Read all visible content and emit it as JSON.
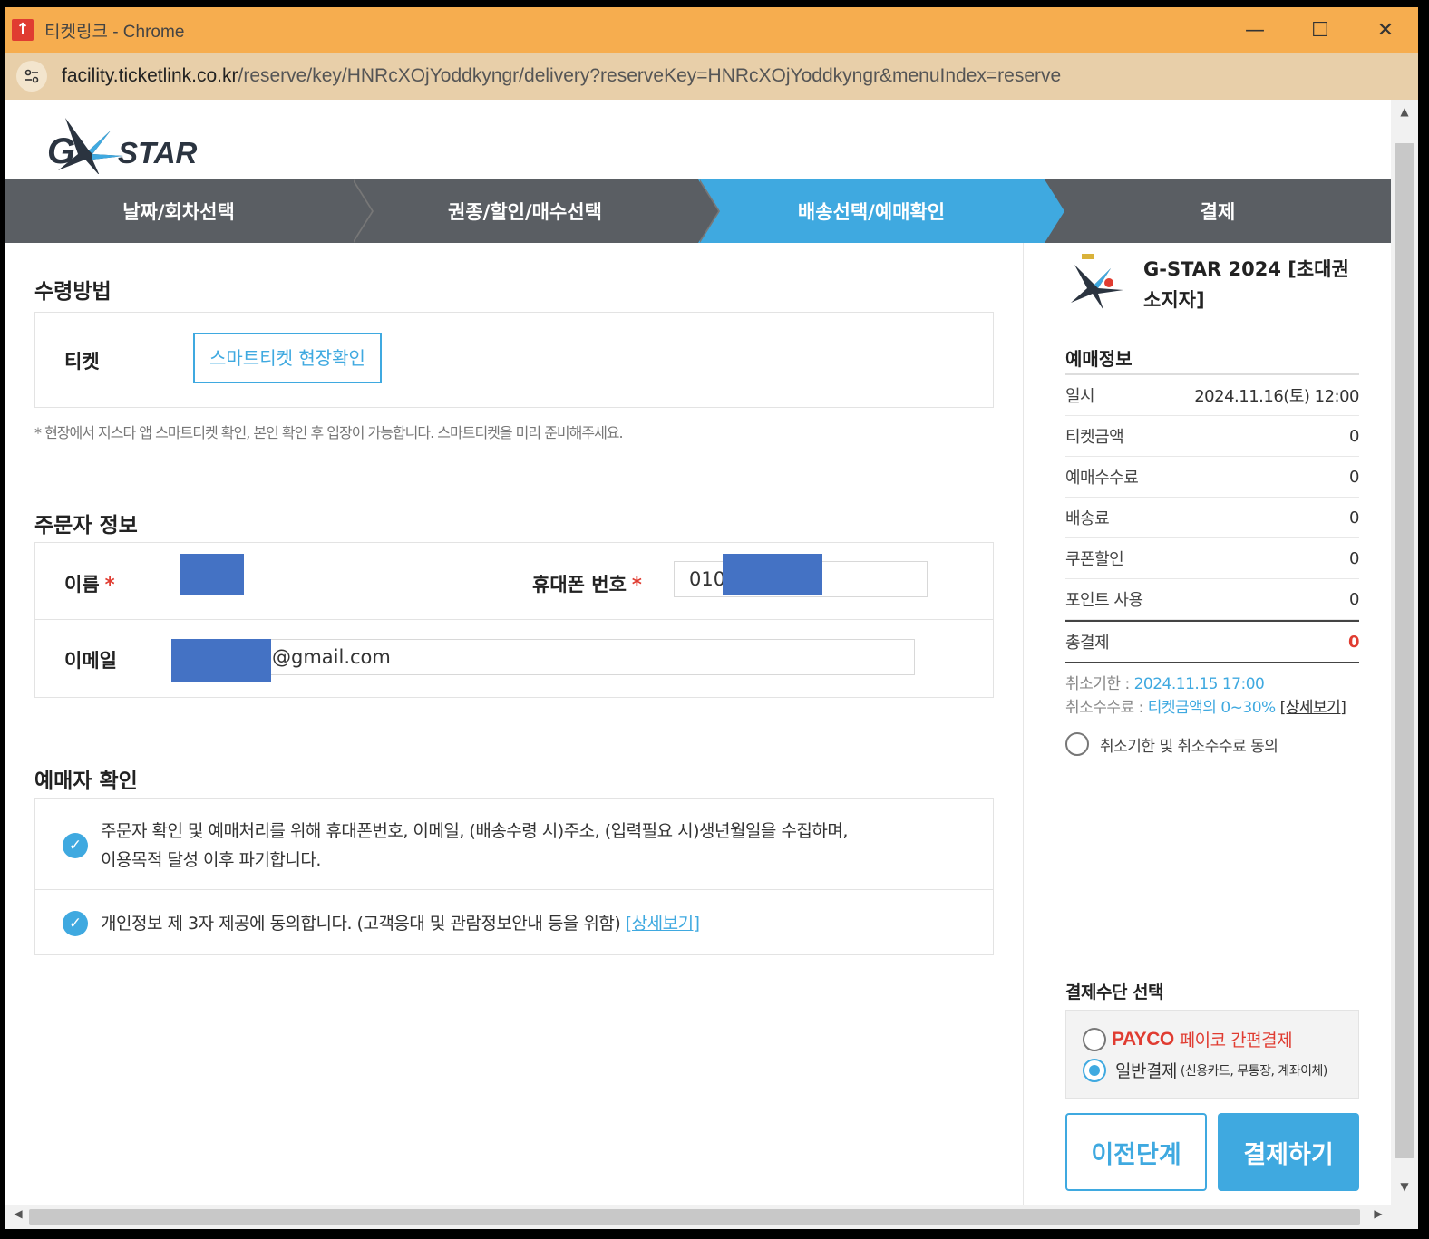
{
  "window": {
    "title": "티켓링크 - Chrome",
    "url_host": "facility.ticketlink.co.kr",
    "url_path": "/reserve/key/HNRcXOjYoddkyngr/delivery?reserveKey=HNRcXOjYoddkyngr&menuIndex=reserve",
    "controls": {
      "minimize": "—",
      "maximize": "☐",
      "close": "✕"
    },
    "app_icon": "↑"
  },
  "logo": {
    "text": "STAR",
    "letter": "G"
  },
  "steps": [
    {
      "label": "날짜/회차선택",
      "active": false
    },
    {
      "label": "권종/할인/매수선택",
      "active": false
    },
    {
      "label": "배송선택/예매확인",
      "active": true
    },
    {
      "label": "결제",
      "active": false
    }
  ],
  "delivery": {
    "title": "수령방법",
    "ticket_label": "티켓",
    "ticket_option": "스마트티켓 현장확인",
    "note": "* 현장에서 지스타 앱 스마트티켓 확인, 본인 확인 후 입장이 가능합니다. 스마트티켓을 미리 준비해주세요."
  },
  "orderer": {
    "title": "주문자 정보",
    "name_label": "이름",
    "phone_label": "휴대폰 번호",
    "phone_value": "010",
    "email_label": "이메일",
    "email_value": "@gmail.com",
    "required_mark": "*"
  },
  "confirm": {
    "title": "예매자 확인",
    "item1_line1": "주문자 확인 및 예매처리를 위해 휴대폰번호, 이메일, (배송수령 시)주소, (입력필요 시)생년월일을 수집하며,",
    "item1_line2": "이용목적 달성 이후 파기합니다.",
    "item2_text": "개인정보 제 3자 제공에 동의합니다. (고객응대 및 관람정보안내 등을 위함)",
    "item2_link": "[상세보기]",
    "check_icon": "✓"
  },
  "summary": {
    "event_title": "G-STAR 2024 [초대권 소지자]",
    "info_title": "예매정보",
    "rows": [
      {
        "label": "일시",
        "value": "2024.11.16(토) 12:00"
      },
      {
        "label": "티켓금액",
        "value": "0"
      },
      {
        "label": "예매수수료",
        "value": "0"
      },
      {
        "label": "배송료",
        "value": "0"
      },
      {
        "label": "쿠폰할인",
        "value": "0"
      },
      {
        "label": "포인트 사용",
        "value": "0"
      }
    ],
    "total_label": "총결제",
    "total_value": "0",
    "cancel_deadline_label": "취소기한 : ",
    "cancel_deadline_value": "2024.11.15 17:00",
    "cancel_fee_label": "취소수수료 : ",
    "cancel_fee_value": "티켓금액의 0~30%",
    "cancel_fee_link": "[상세보기]",
    "agree_cancel": "취소기한 및 취소수수료 동의"
  },
  "payment": {
    "title": "결제수단 선택",
    "payco_brand": "PAYCO",
    "payco_label": "페이코 간편결제",
    "general_label": "일반결제",
    "general_sub": "(신용카드, 무통장, 계좌이체)",
    "selected": "general",
    "prev_button": "이전단계",
    "pay_button": "결제하기"
  }
}
